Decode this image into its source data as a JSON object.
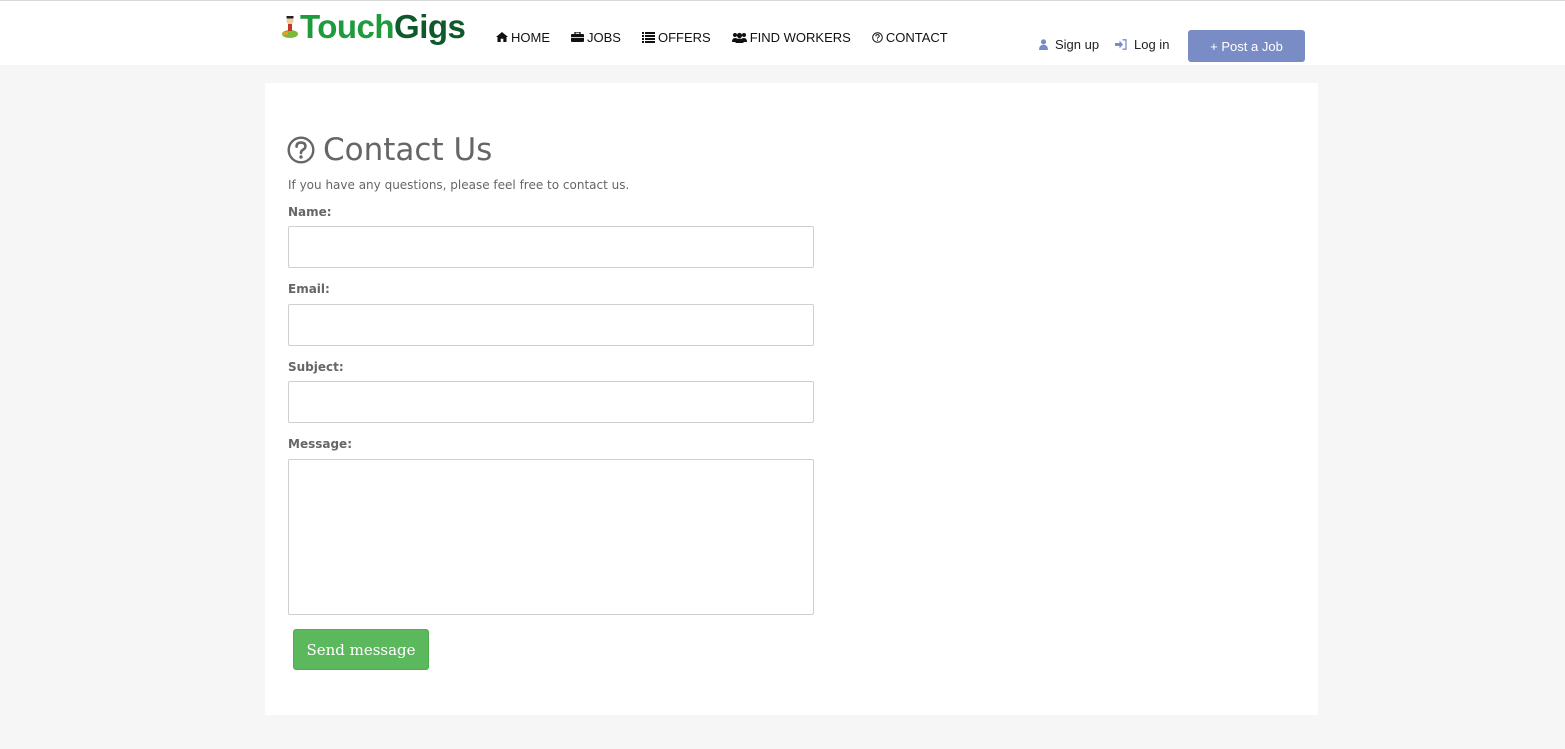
{
  "brand": {
    "name_part1": "Touch",
    "name_part2": "Gigs",
    "icon": "mascot-logo-icon",
    "colors": {
      "touch": "#1f9a3c",
      "gigs": "#0e5a2a"
    }
  },
  "nav": {
    "items": [
      {
        "label": "HOME",
        "icon": "home-icon"
      },
      {
        "label": "JOBS",
        "icon": "briefcase-icon"
      },
      {
        "label": "OFFERS",
        "icon": "list-icon"
      },
      {
        "label": "FIND WORKERS",
        "icon": "users-icon"
      },
      {
        "label": "CONTACT",
        "icon": "question-circle-icon"
      }
    ]
  },
  "auth": {
    "signup_label": "Sign up",
    "login_label": "Log in",
    "post_job_label": "+ Post a Job"
  },
  "contact": {
    "title": "Contact Us",
    "subtitle": "If you have any questions, please feel free to contact us.",
    "fields": {
      "name": {
        "label": "Name:",
        "value": "",
        "placeholder": ""
      },
      "email": {
        "label": "Email:",
        "value": "",
        "placeholder": ""
      },
      "subject": {
        "label": "Subject:",
        "value": "",
        "placeholder": ""
      },
      "message": {
        "label": "Message:",
        "value": "",
        "placeholder": ""
      }
    },
    "send_label": "Send message"
  },
  "colors": {
    "page_bg": "#f6f6f6",
    "accent_button": "#7a8cc6",
    "send_button": "#5cb85c",
    "icon_blue": "#7a8cc6"
  }
}
